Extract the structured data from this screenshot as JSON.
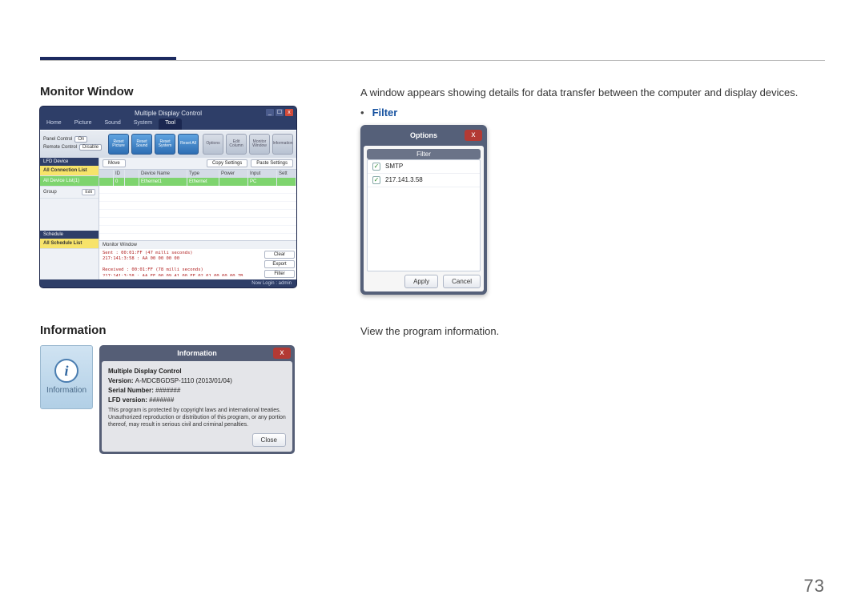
{
  "page_number": "73",
  "section_monitor": {
    "title": "Monitor Window",
    "description": "A window appears showing details for data transfer between the computer and display devices.",
    "filter_label": "Filter"
  },
  "section_info": {
    "title": "Information",
    "description": "View the program information."
  },
  "mdc": {
    "title": "Multiple Display Control",
    "win_min": "_",
    "win_max": "☐",
    "win_close": "x",
    "tabs": [
      "Home",
      "Picture",
      "Sound",
      "System",
      "Tool"
    ],
    "left": {
      "panel_control_label": "Panel Control",
      "panel_control_value": "On",
      "remote_control_label": "Remote Control",
      "remote_control_value": "Disable"
    },
    "tools": [
      "Reset Picture",
      "Reset Sound",
      "Reset System",
      "Reset All"
    ],
    "tools_right": [
      "Options",
      "Edit Column",
      "Monitor Window",
      "Information"
    ],
    "sidebar": {
      "head1": "LFD Device",
      "conn_list": "All Connection List",
      "device_list": "All Device List(1)",
      "group": "Group",
      "edit": "Edit",
      "head2": "Schedule",
      "sched_list": "All Schedule List"
    },
    "gridbar": {
      "move": "Move",
      "copy": "Copy Settings",
      "paste": "Paste Settings"
    },
    "gridhead": [
      "",
      "ID",
      "",
      "Device Name",
      "Type",
      "Power",
      "Input",
      "Sett"
    ],
    "gridrow": [
      "",
      "0",
      "",
      "Ethernet1",
      "Ethernet",
      "",
      "PC",
      ""
    ],
    "monitor": {
      "title": "Monitor Window",
      "log": "Sent : 00:01:FF (47 milli seconds)\n217:141:3:58 : AA 00 00 00 00\n\nReceived : 00:01:FF (78 milli seconds)\n217:141:3:58 : AA FF 00 09 41 00 FF 02 01 00 00 00 7B",
      "btns": [
        "Clear",
        "Export",
        "Filter"
      ]
    },
    "status": "Now Login : admin"
  },
  "filter_dialog": {
    "title": "Options",
    "subtitle": "Filter",
    "items": [
      "SMTP",
      "217.141.3.58"
    ],
    "buttons": [
      "Apply",
      "Cancel"
    ]
  },
  "info_card": {
    "label": "Information",
    "glyph": "i"
  },
  "info_dialog": {
    "title": "Information",
    "close": "x",
    "product": "Multiple Display Control",
    "version_label": "Version: ",
    "version_value": "A-MDCBGDSP-1110 (2013/01/04)",
    "serial_label": "Serial Number: ",
    "serial_value": "#######",
    "lfd_label": "LFD version: ",
    "lfd_value": "#######",
    "legal": "This program is protected by copyright laws and international treaties. Unauthorized reproduction or distribution of this program, or any portion thereof, may result in serious civil and criminal penalties.",
    "close_btn": "Close"
  }
}
